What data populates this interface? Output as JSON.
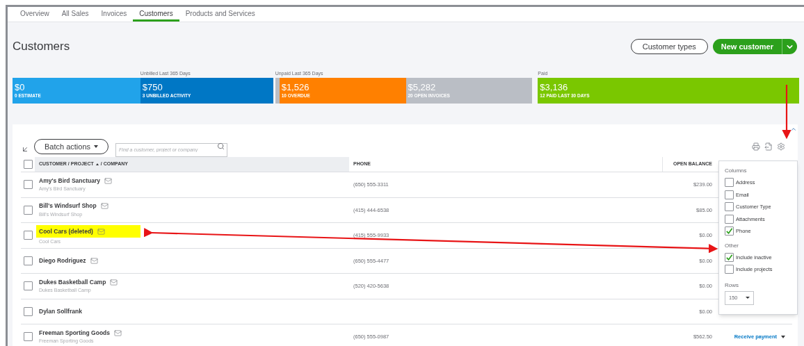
{
  "tabs": [
    {
      "label": "Overview",
      "selected": false
    },
    {
      "label": "All Sales",
      "selected": false
    },
    {
      "label": "Invoices",
      "selected": false
    },
    {
      "label": "Customers",
      "selected": true
    },
    {
      "label": "Products and Services",
      "selected": false
    }
  ],
  "page_title": "Customers",
  "header_buttons": [
    {
      "kind": "outline",
      "label": "Customer types"
    },
    {
      "kind": "split",
      "label": "New customer"
    }
  ],
  "stat_groups": [
    {
      "segments": [
        {
          "amount": "$0",
          "caption": "0 ESTIMATE",
          "color": "#21a3ea"
        }
      ]
    },
    {
      "label": "Unbilled Last 365 Days",
      "segments": [
        {
          "amount": "$750",
          "caption": "3 UNBILLED ACTIVITY",
          "color": "#0077c5"
        }
      ]
    },
    {
      "label": "Unpaid Last 365 Days",
      "segments": [
        {
          "amount": "$1,526",
          "caption": "10 OVERDUE",
          "color": "#ff8000"
        },
        {
          "amount": "$5,282",
          "caption": "20 OPEN INVOICES",
          "color": "#babec5"
        }
      ]
    },
    {
      "label": "Paid",
      "segments": [
        {
          "amount": "$3,136",
          "caption": "12 PAID LAST 30 DAYS",
          "color": "#7ac700"
        }
      ]
    }
  ],
  "toolbar": {
    "batch_button": "Batch actions",
    "search": {
      "placeholder": "Find a customer, project or company"
    }
  },
  "table": {
    "columns": [
      {
        "label": "CUSTOMER / PROJECT",
        "sorted": true,
        "suffix": "/ COMPANY"
      },
      {
        "label": "PHONE",
        "sorted": false
      },
      {
        "label": "OPEN BALANCE",
        "sorted": false
      }
    ],
    "select_all_checked": false,
    "rows": [
      {
        "name": "Amy's Bird Sanctuary",
        "company": "Amy's Bird Sanctuary",
        "email": true,
        "highlighted": false,
        "checked": false,
        "phone": "(650) 555-3311",
        "balance": "$239.00"
      },
      {
        "name": "Bill's Windsurf Shop",
        "company": "Bill's Windsurf Shop",
        "email": true,
        "highlighted": false,
        "checked": false,
        "phone": "(415) 444-6538",
        "balance": "$85.00"
      },
      {
        "name": "Cool Cars (deleted)",
        "company": "Cool Cars",
        "email": true,
        "highlighted": true,
        "checked": false,
        "phone": "(415) 555-9933",
        "balance": "$0.00"
      },
      {
        "name": "Diego Rodriguez",
        "email": true,
        "highlighted": false,
        "checked": false,
        "phone": "(650) 555-4477",
        "balance": "$0.00"
      },
      {
        "name": "Dukes Basketball Camp",
        "company": "Dukes Basketball Camp",
        "email": true,
        "highlighted": false,
        "checked": false,
        "phone": "(520) 420-5638",
        "balance": "$0.00"
      },
      {
        "name": "Dylan Sollfrank",
        "email": false,
        "highlighted": false,
        "checked": false,
        "balance": "$0.00"
      },
      {
        "name": "Freeman Sporting Goods",
        "company": "Freeman Sporting Goods",
        "email": true,
        "highlighted": false,
        "checked": false,
        "phone": "(650) 555-0987",
        "balance": "$562.50",
        "action": "Receive payment"
      }
    ]
  },
  "settings_menu": {
    "sections": [
      {
        "title": "Columns",
        "items": [
          {
            "label": "Address",
            "checked": false
          },
          {
            "label": "Email",
            "checked": false
          },
          {
            "label": "Customer Type",
            "checked": false
          },
          {
            "label": "Attachments",
            "checked": false
          },
          {
            "label": "Phone",
            "checked": true
          }
        ]
      },
      {
        "title": "Other",
        "items": [
          {
            "label": "Include inactive",
            "checked": true
          },
          {
            "label": "Include projects",
            "checked": false
          }
        ]
      }
    ],
    "rows_label": "Rows",
    "rows_value": "150"
  }
}
